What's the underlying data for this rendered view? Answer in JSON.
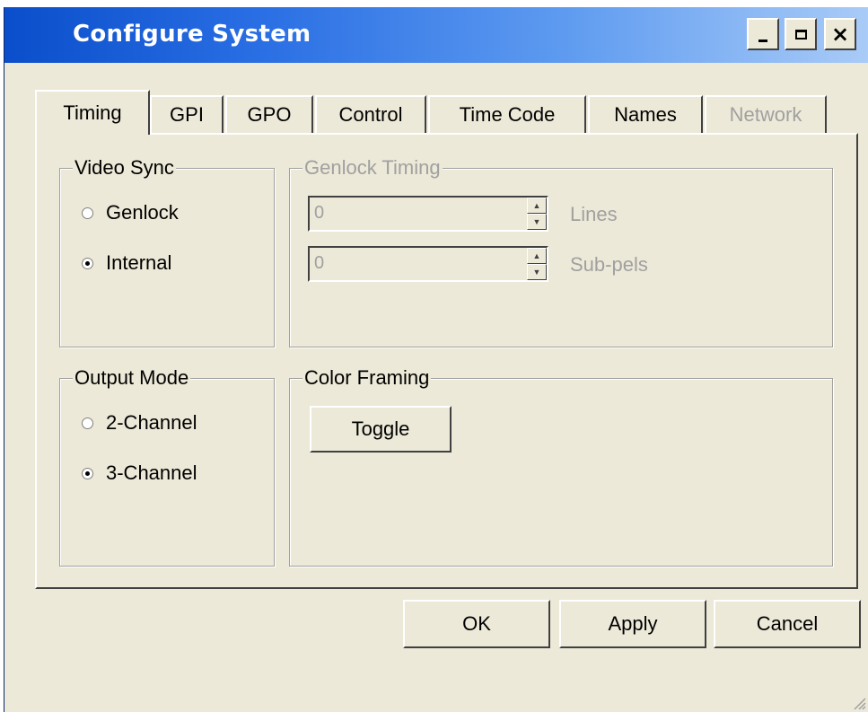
{
  "window": {
    "title": "Configure System"
  },
  "caption_buttons": {
    "minimize": "minimize",
    "maximize": "maximize",
    "close": "×"
  },
  "tabs": [
    {
      "label": "Timing",
      "active": true,
      "enabled": true
    },
    {
      "label": "GPI",
      "active": false,
      "enabled": true
    },
    {
      "label": "GPO",
      "active": false,
      "enabled": true
    },
    {
      "label": "Control",
      "active": false,
      "enabled": true
    },
    {
      "label": "Time Code",
      "active": false,
      "enabled": true
    },
    {
      "label": "Names",
      "active": false,
      "enabled": true
    },
    {
      "label": "Network",
      "active": false,
      "enabled": false
    }
  ],
  "video_sync": {
    "legend": "Video Sync",
    "options": [
      {
        "label": "Genlock",
        "selected": false
      },
      {
        "label": "Internal",
        "selected": true
      }
    ]
  },
  "genlock_timing": {
    "legend": "Genlock Timing",
    "enabled": false,
    "lines": {
      "value": "0",
      "unit": "Lines"
    },
    "subpels": {
      "value": "0",
      "unit": "Sub-pels"
    }
  },
  "output_mode": {
    "legend": "Output Mode",
    "options": [
      {
        "label": "2-Channel",
        "selected": false
      },
      {
        "label": "3-Channel",
        "selected": true
      }
    ]
  },
  "color_framing": {
    "legend": "Color Framing",
    "toggle_label": "Toggle"
  },
  "footer": {
    "ok_label": "OK",
    "apply_label": "Apply",
    "cancel_label": "Cancel"
  },
  "colors": {
    "title_start": "#0A4ECB",
    "title_end": "#A9CBF7",
    "face": "#ECE9D8",
    "disabled_text": "#A0A0A0"
  }
}
